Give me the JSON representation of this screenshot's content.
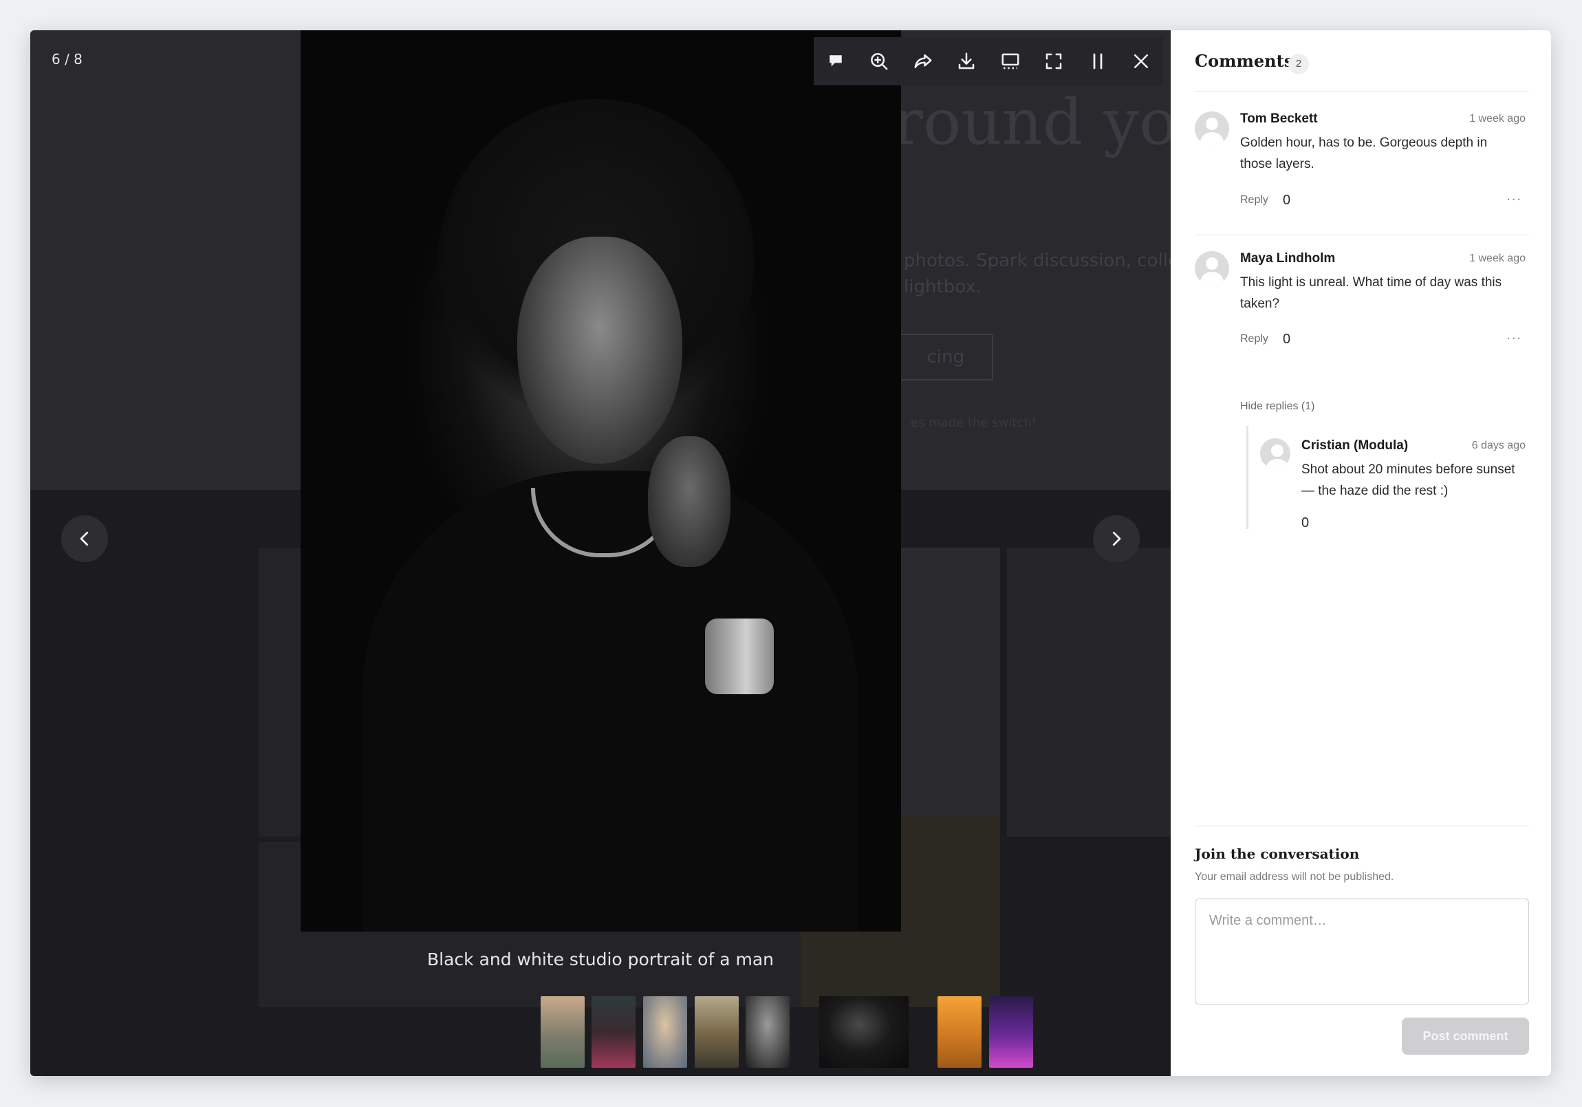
{
  "viewer": {
    "counter": "6 / 8",
    "caption": "Black and white studio portrait of a man",
    "background_page": {
      "heading": "round your",
      "text": "photos. Spark discussion, collect ur Modula lightbox.",
      "button": "cing",
      "small": "es made the switch!"
    },
    "toolbar": [
      {
        "name": "comment-icon"
      },
      {
        "name": "zoom-in-icon"
      },
      {
        "name": "share-icon"
      },
      {
        "name": "download-icon"
      },
      {
        "name": "thumbnails-icon"
      },
      {
        "name": "fullscreen-icon"
      },
      {
        "name": "pause-icon"
      },
      {
        "name": "close-icon"
      }
    ],
    "thumbnails": [
      {
        "name": "thumb-mountain-sunset",
        "colors": [
          "#c9a98a",
          "#5b6b5a"
        ]
      },
      {
        "name": "thumb-neon-street",
        "colors": [
          "#2d3b3c",
          "#a03858"
        ]
      },
      {
        "name": "thumb-woman-portrait",
        "colors": [
          "#dcc4a4",
          "#5a6a7a"
        ]
      },
      {
        "name": "thumb-misty-valley",
        "colors": [
          "#b3a98c",
          "#3e3a30"
        ]
      },
      {
        "name": "thumb-man-portrait",
        "colors": [
          "#9a9a9a",
          "#1c1c1c"
        ]
      },
      {
        "name": "thumb-bw-portrait-active",
        "colors": [
          "#2a2a2a",
          "#0a0a0a"
        ]
      },
      {
        "name": "thumb-orange-mountains",
        "colors": [
          "#f4a33a",
          "#a05a18"
        ]
      },
      {
        "name": "thumb-purple-city",
        "colors": [
          "#6a2a9a",
          "#d04ac8"
        ]
      }
    ]
  },
  "comments": {
    "title": "Comments",
    "count": "2",
    "items": [
      {
        "author": "Tom Beckett",
        "time": "1 week ago",
        "text": "Golden hour, has to be. Gorgeous depth in those layers.",
        "reply_label": "Reply",
        "likes": "0",
        "more": "..."
      },
      {
        "author": "Maya Lindholm",
        "time": "1 week ago",
        "text": "This light is unreal. What time of day was this taken?",
        "reply_label": "Reply",
        "likes": "0",
        "more": "...",
        "hide_replies_label": "Hide replies (1)",
        "replies": [
          {
            "author": "Cristian (Modula)",
            "time": "6 days ago",
            "text": "Shot about 20 minutes before sunset — the haze did the rest :)",
            "likes": "0"
          }
        ]
      }
    ],
    "join": {
      "title": "Join the conversation",
      "subtitle": "Your email address will not be published.",
      "placeholder": "Write a comment…",
      "post_label": "Post comment"
    }
  }
}
